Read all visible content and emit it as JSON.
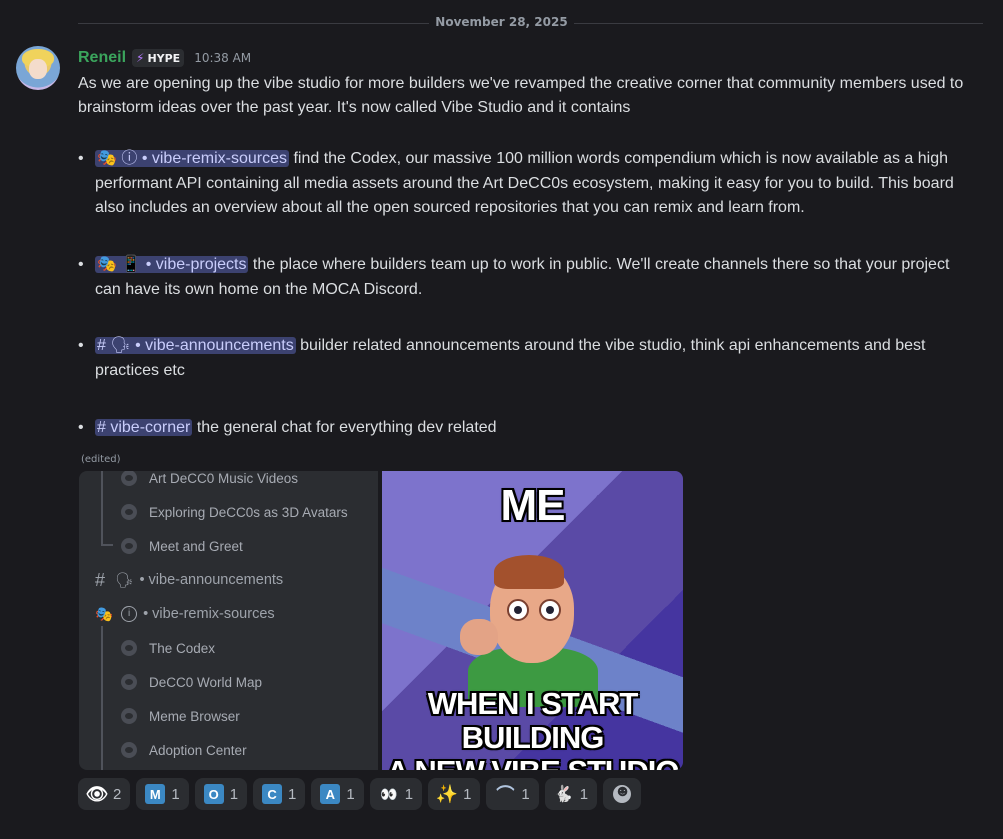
{
  "date_divider": "November 28, 2025",
  "message": {
    "author": "Reneil",
    "tag": "HYPE",
    "timestamp": "10:38 AM",
    "intro": "As we are opening up the vibe studio for more builders we've revamped the creative corner that community members used to brainstorm ideas over the past year. It's now called Vibe Studio and it contains",
    "bullets": [
      {
        "channel": "🎭 ⓘ • vibe-remix-sources",
        "text": " find the Codex, our massive 100 million words compendium which is now available as a high performant API containing all media assets around the Art DeCC0s ecosystem, making it easy for you to build. This board also includes an overview about all the open sourced repositories that you can remix and learn from."
      },
      {
        "channel": "🎭 📱 • vibe-projects",
        "text": " the place where builders team up to work in public. We'll create channels there so that your project can have its own home on the MOCA Discord."
      },
      {
        "channel": "# 🗣 • vibe-announcements",
        "text": " builder related announcements around the vibe studio, think api enhancements and best practices etc"
      },
      {
        "channel": "# vibe-corner",
        "text": " the general chat for everything dev related"
      }
    ],
    "edited": "(edited)"
  },
  "screenshot": {
    "rows": [
      "Art DeCC0 Music Videos",
      "Exploring DeCC0s as 3D Avatars",
      "Meet and Greet",
      "• vibe-announcements",
      "• vibe-remix-sources",
      "The Codex",
      "DeCC0 World Map",
      "Meme Browser",
      "Adoption Center"
    ]
  },
  "meme": {
    "top": "ME",
    "bottom_line1": "WHEN I START BUILDING",
    "bottom_line2": "A NEW VIBE STUDIO APP"
  },
  "reactions": [
    {
      "icon": "eye-emoji",
      "count": "2"
    },
    {
      "icon": "letter-m",
      "label": "M",
      "count": "1"
    },
    {
      "icon": "letter-o",
      "label": "O",
      "count": "1"
    },
    {
      "icon": "letter-c",
      "label": "C",
      "count": "1"
    },
    {
      "icon": "letter-a",
      "label": "A",
      "count": "1"
    },
    {
      "icon": "owl-emoji",
      "count": "1"
    },
    {
      "icon": "sparkles-emoji",
      "count": "1"
    },
    {
      "icon": "arc-emoji",
      "count": "1"
    },
    {
      "icon": "rabbit-emoji",
      "count": "1"
    }
  ]
}
